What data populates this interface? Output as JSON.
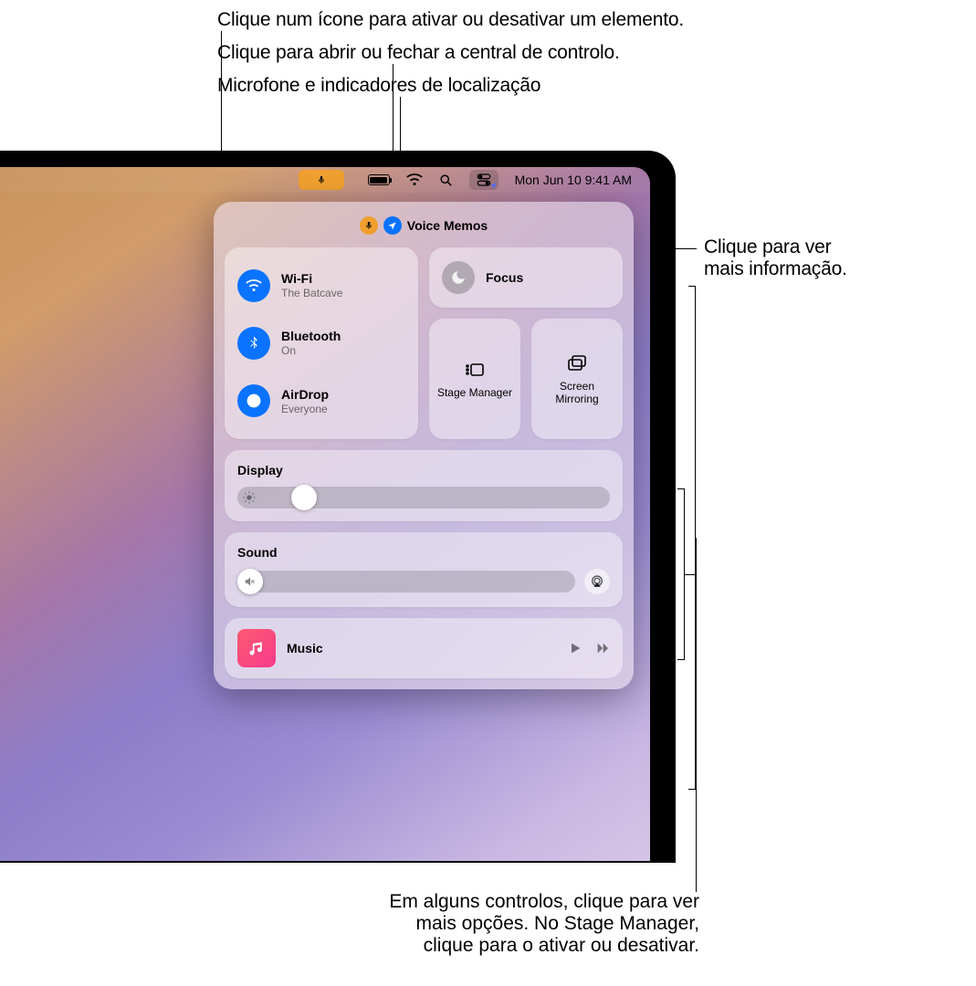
{
  "callouts": {
    "toggle": "Clique num ícone para ativar ou desativar um elemento.",
    "open_cc": "Clique para abrir ou fechar a central de controlo.",
    "mic_loc": "Microfone e indicadores de localização",
    "more_info_1": "Clique para ver",
    "more_info_2": "mais informação.",
    "bottom_1": "Em alguns controlos, clique para ver",
    "bottom_2": "mais opções. No Stage Manager,",
    "bottom_3": "clique para o ativar ou desativar."
  },
  "menubar": {
    "datetime": "Mon Jun 10  9:41 AM"
  },
  "indicators": {
    "app_using": "Voice Memos"
  },
  "connectivity": {
    "wifi": {
      "title": "Wi-Fi",
      "sub": "The Batcave"
    },
    "bluetooth": {
      "title": "Bluetooth",
      "sub": "On"
    },
    "airdrop": {
      "title": "AirDrop",
      "sub": "Everyone"
    }
  },
  "focus": {
    "title": "Focus"
  },
  "stage_manager": {
    "label": "Stage Manager"
  },
  "screen_mirroring": {
    "label": "Screen Mirroring"
  },
  "display": {
    "label": "Display",
    "value_pct": 18
  },
  "sound": {
    "label": "Sound",
    "value_pct": 0
  },
  "music": {
    "title": "Music"
  }
}
